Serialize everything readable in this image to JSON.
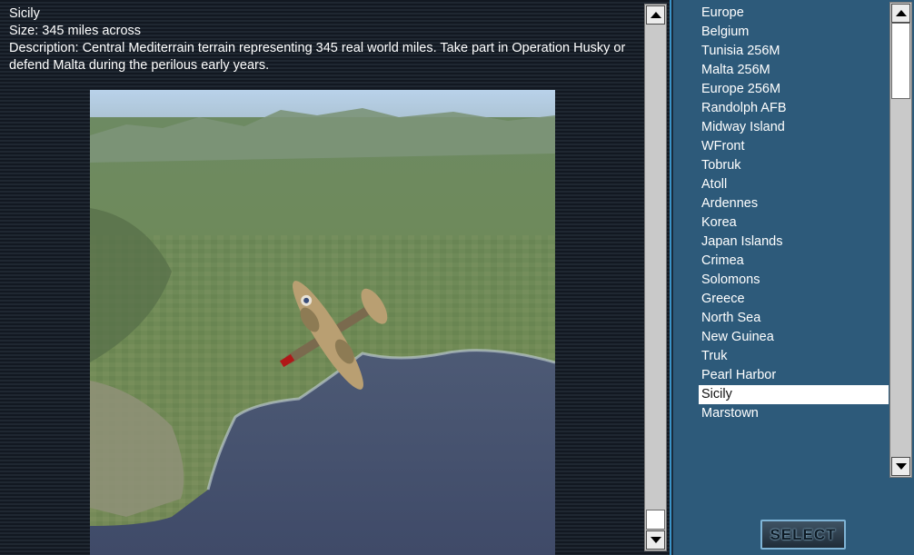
{
  "info": {
    "map_name": "Sicily",
    "size": "Size: 345 miles across",
    "description": "Description: Central Mediterrain terrain representing 345 real world miles. Take part in Operation Husky or defend Malta during the perilous early years."
  },
  "maps": [
    "Europe",
    "Belgium",
    "Tunisia 256M",
    "Malta 256M",
    "Europe 256M",
    "Randolph AFB",
    "Midway Island",
    "WFront",
    "Tobruk",
    "Atoll",
    "Ardennes",
    "Korea",
    "Japan Islands",
    "Crimea",
    "Solomons",
    "Greece",
    "North Sea",
    "New Guinea",
    "Truk",
    "Pearl Harbor",
    "Sicily",
    "Marstown"
  ],
  "selected_map": "Sicily",
  "select_button_label": "SELECT",
  "icons": {
    "scroll_up": "arrow-up-icon",
    "scroll_down": "arrow-down-icon"
  },
  "colors": {
    "list_background": "#2d5a7a",
    "selection_highlight": "#ffffff",
    "panel_divider": "#3a93c8"
  }
}
